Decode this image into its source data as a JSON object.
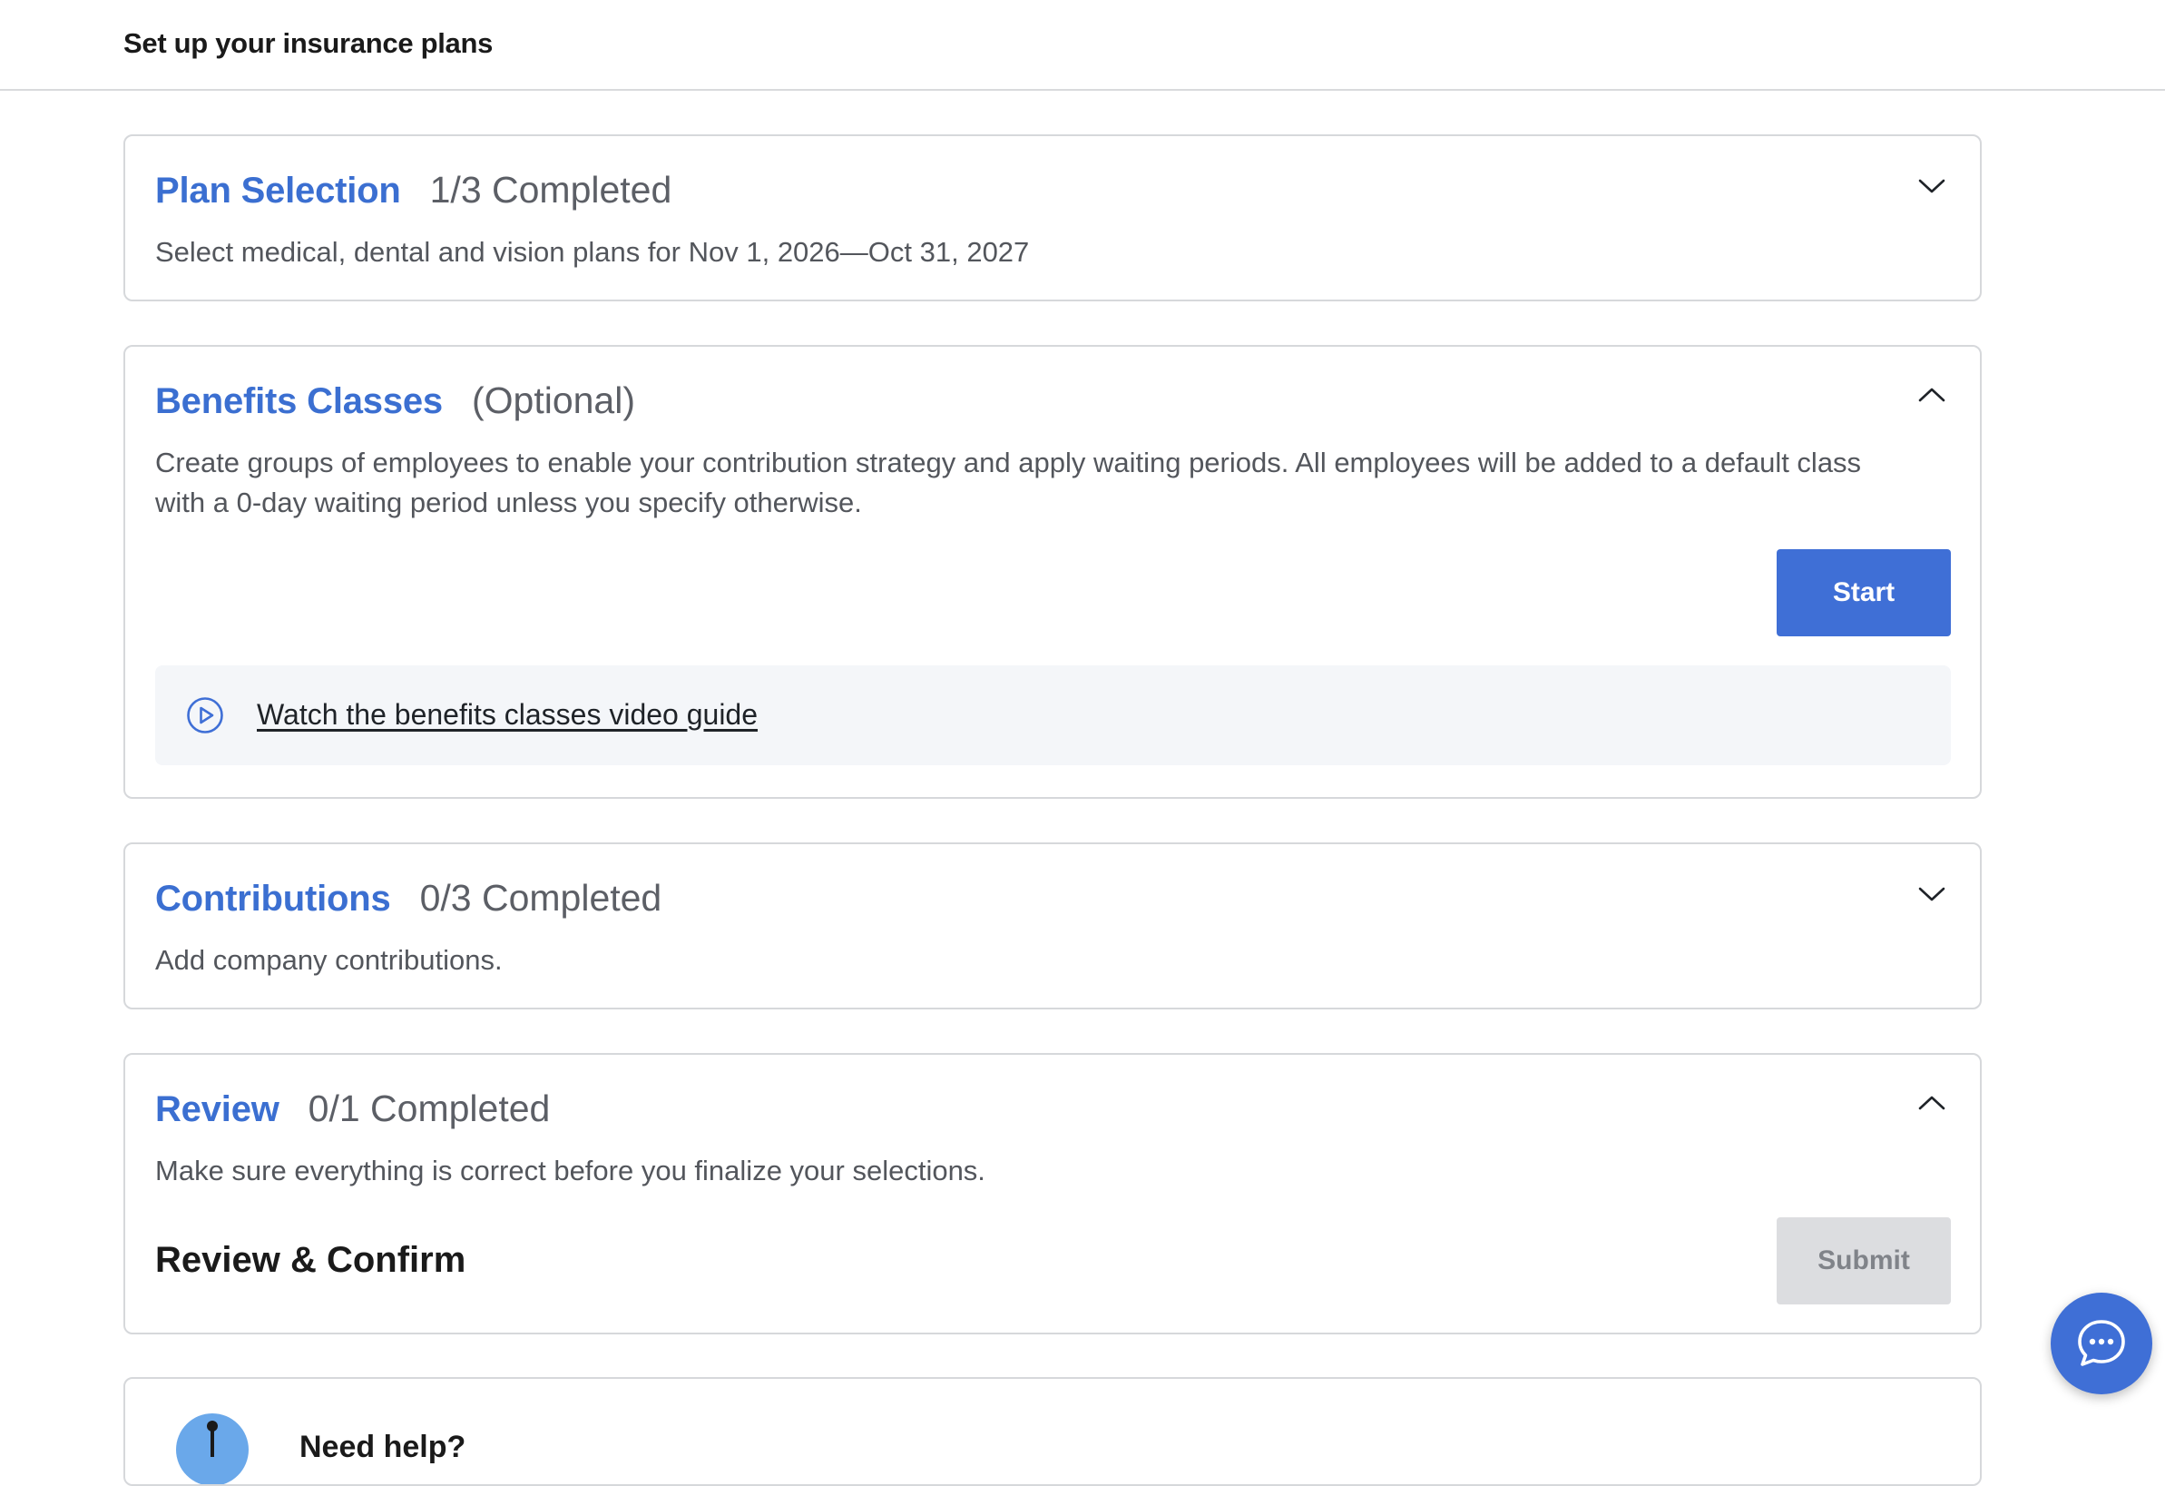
{
  "header": {
    "title": "Set up your insurance plans"
  },
  "sections": [
    {
      "title": "Plan Selection",
      "status": "1/3 Completed",
      "description": "Select medical, dental and vision plans for Nov 1, 2026—Oct 31, 2027",
      "expanded": false
    },
    {
      "title": "Benefits Classes",
      "status": "(Optional)",
      "description": "Create groups of employees to enable your contribution strategy and apply waiting periods. All employees will be added to a default class with a 0-day waiting period unless you specify otherwise.",
      "expanded": true,
      "button_label": "Start",
      "video_link": "Watch the benefits classes video guide"
    },
    {
      "title": "Contributions",
      "status": "0/3 Completed",
      "description": "Add company contributions.",
      "expanded": false
    },
    {
      "title": "Review",
      "status": "0/1 Completed",
      "description": "Make sure everything is correct before you finalize your selections.",
      "expanded": true,
      "confirm_label": "Review & Confirm",
      "button_label": "Submit"
    }
  ],
  "help": {
    "label": "Need help?"
  },
  "icons": {
    "chevron_down": "chevron-down-icon",
    "chevron_up": "chevron-up-icon",
    "play": "play-circle-icon",
    "chat": "chat-bubble-icon"
  },
  "colors": {
    "accent": "#3f6fd6",
    "title_blue": "#3b6fd1",
    "disabled_bg": "#dcdde0",
    "video_bg": "#f4f6f9"
  }
}
